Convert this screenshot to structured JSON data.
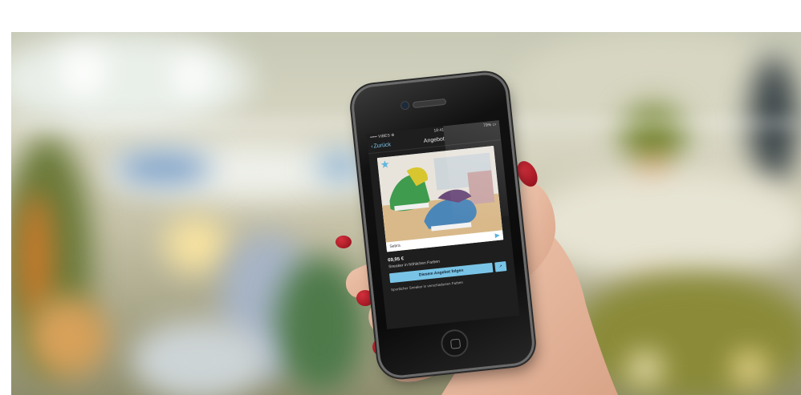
{
  "scene": {
    "description_color_palette": {
      "mall_bg": "#c7c9b6",
      "screen_bg": "#1e1e1e",
      "accent": "#79c4e6",
      "nail_polish": "#b31a28",
      "skin": "#e8bfa6"
    }
  },
  "phone": {
    "status": {
      "carrier": "••••• VIBES ⊕",
      "time": "18:41",
      "battery": "79% ▭"
    },
    "navbar": {
      "back_label": "Zurück",
      "title": "Angebot"
    },
    "product": {
      "caption": "Sebra",
      "price": "69,95 €",
      "short_description": "Sneaker in fröhlichen Farben",
      "cta_label": "Diesem Angebot folgen",
      "share_label": "↗",
      "long_description": "Sportlicher Sneaker in verschiedenen Farben"
    }
  }
}
